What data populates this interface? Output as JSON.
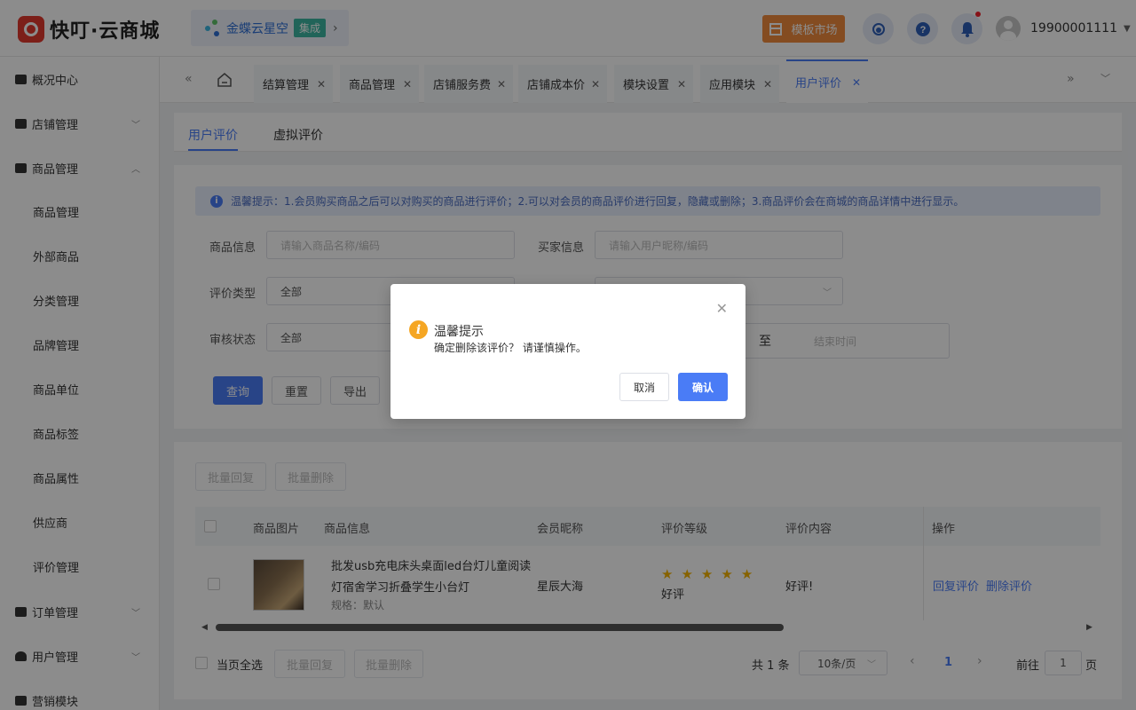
{
  "header": {
    "logo_text": "快叮·云商城",
    "brand": {
      "name": "金蝶云星空",
      "tag": "集成"
    },
    "template_button": "模板市场",
    "user": "19900001111"
  },
  "sidebar": {
    "items": [
      {
        "label": "概况中心"
      },
      {
        "label": "店铺管理"
      },
      {
        "label": "商品管理"
      },
      {
        "label": "订单管理"
      },
      {
        "label": "用户管理"
      },
      {
        "label": "营销模块"
      }
    ],
    "subitems": [
      "商品管理",
      "外部商品",
      "分类管理",
      "品牌管理",
      "商品单位",
      "商品标签",
      "商品属性",
      "供应商",
      "评价管理"
    ]
  },
  "tabs": [
    "结算管理",
    "商品管理",
    "店铺服务费",
    "店铺成本价",
    "模块设置",
    "应用模块",
    "用户评价"
  ],
  "subtabs": [
    "用户评价",
    "虚拟评价"
  ],
  "notice": "温馨提示：1.会员购买商品之后可以对购买的商品进行评价；2.可以对会员的商品评价进行回复，隐藏或删除；3.商品评价会在商城的商品详情中进行显示。",
  "filters": {
    "product_label": "商品信息",
    "product_placeholder": "请输入商品名称/编码",
    "buyer_label": "买家信息",
    "buyer_placeholder": "请输入用户昵称/编码",
    "type_label": "评价类型",
    "type_value": "全部",
    "status_label": "审核状态",
    "status_value": "全部",
    "range_sep": "至",
    "end_placeholder": "结束时间"
  },
  "buttons": {
    "query": "查询",
    "reset": "重置",
    "export": "导出",
    "batch_reply": "批量回复",
    "batch_delete": "批量删除"
  },
  "table": {
    "columns": [
      "商品图片",
      "商品信息",
      "会员昵称",
      "评价等级",
      "评价内容",
      "操作"
    ],
    "rows": [
      {
        "title_line1": "批发usb充电床头桌面led台灯儿童阅读",
        "title_line2": "灯宿舍学习折叠学生小台灯",
        "spec": "规格：默认",
        "member": "星辰大海",
        "rating": 5,
        "rating_text": "好评",
        "content": "好评!",
        "actions": [
          "回复评价",
          "删除评价"
        ]
      }
    ]
  },
  "footer": {
    "select_all": "当页全选",
    "total": "共 1 条",
    "page_size": "10条/页",
    "current_page": "1",
    "goto_label": "前往",
    "goto_value": "1",
    "page_unit": "页"
  },
  "dialog": {
    "title": "温馨提示",
    "message": "确定删除该评价？ 请谨慎操作。",
    "cancel": "取消",
    "confirm": "确认"
  },
  "colors": {
    "primary": "#4a7cf6",
    "orange": "#f08a3c",
    "logo_red": "#e23a2f",
    "star": "#f5b300"
  }
}
